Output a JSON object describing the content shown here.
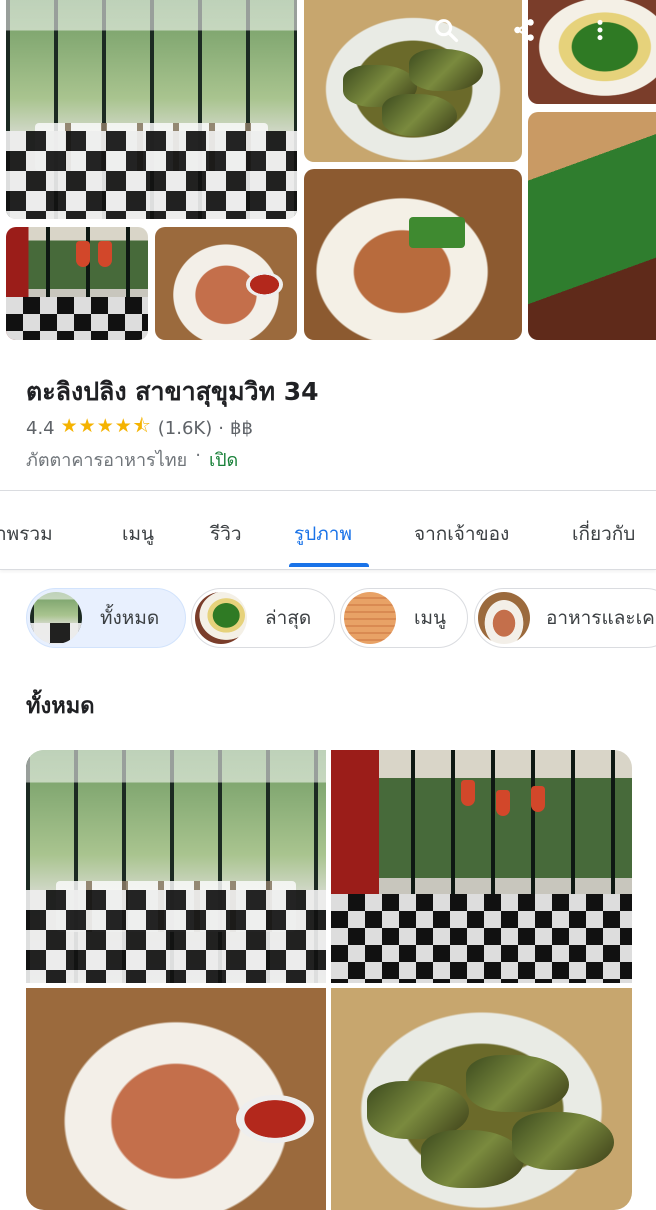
{
  "place": {
    "name": "ตะลิงปลิง สาขาสุขุมวิท 34",
    "rating": "4.4",
    "stars": "★★★★⯪",
    "review_count": "(1.6K)",
    "price": "฿฿",
    "category": "ภัตตาคารอาหารไทย",
    "status": "เปิด",
    "separator": "·"
  },
  "tabs": [
    {
      "label": "าพรวม",
      "active": false
    },
    {
      "label": "เมนู",
      "active": false
    },
    {
      "label": "รีวิว",
      "active": false
    },
    {
      "label": "รูปภาพ",
      "active": true
    },
    {
      "label": "จากเจ้าของ",
      "active": false
    },
    {
      "label": "เกี่ยวกับ",
      "active": false
    }
  ],
  "chips": [
    {
      "label": "ทั้งหมด",
      "active": true
    },
    {
      "label": "ล่าสุด",
      "active": false
    },
    {
      "label": "เมนู",
      "active": false
    },
    {
      "label": "อาหารและเค",
      "active": false
    }
  ],
  "section_title": "ทั้งหมด",
  "icons": {
    "search": "search-icon",
    "share": "share-icon",
    "more": "more-vert-icon"
  },
  "colors": {
    "accent": "#1a73e8",
    "star": "#f5b301",
    "open": "#188038"
  }
}
